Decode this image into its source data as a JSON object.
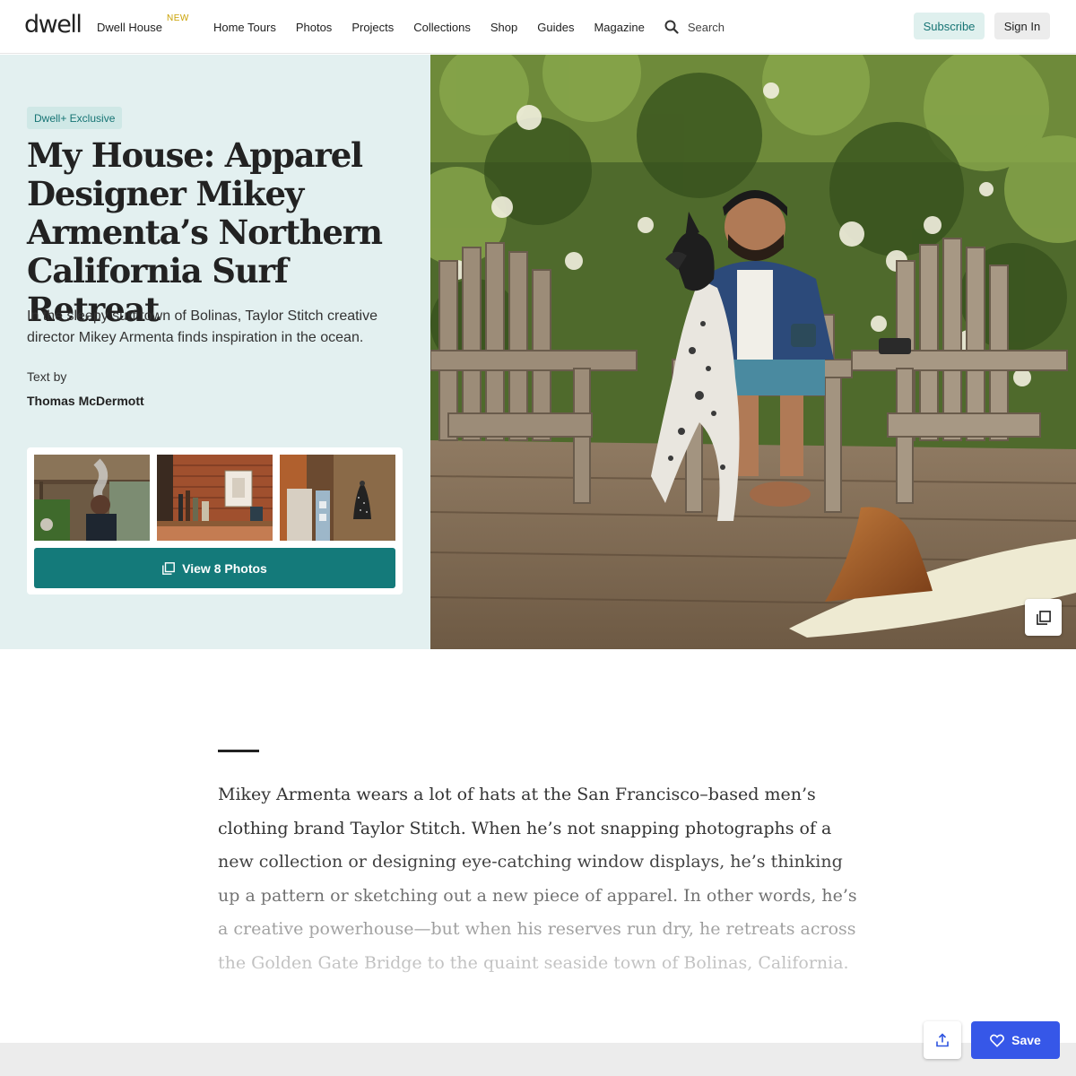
{
  "brand": {
    "logo_text": "dwell"
  },
  "nav": {
    "items": [
      {
        "label": "Dwell House",
        "tag": "NEW"
      },
      {
        "label": "Home Tours"
      },
      {
        "label": "Photos"
      },
      {
        "label": "Projects"
      },
      {
        "label": "Collections"
      },
      {
        "label": "Shop"
      },
      {
        "label": "Guides"
      },
      {
        "label": "Magazine"
      }
    ],
    "search_label": "Search",
    "subscribe_label": "Subscribe",
    "signin_label": "Sign In"
  },
  "hero": {
    "badge": "Dwell+ Exclusive",
    "title": "My House: Apparel Designer Mikey Armenta’s Northern California Surf Retreat",
    "dek": "In the sleepy surf town of Bolinas, Taylor Stitch creative director Mikey Armenta finds inspiration in the ocean.",
    "byline_label": "Text by",
    "byline_name": "Thomas McDermott",
    "gallery_button": "View 8 Photos"
  },
  "article": {
    "body": "Mikey Armenta wears a lot of hats at the San Francisco–based men’s clothing brand Taylor Stitch. When he’s not snapping photographs of a new collection or designing eye-catching window displays, he’s thinking up a pattern or sketching out a new piece of apparel. In other words, he’s a creative powerhouse—but when his reserves run dry, he retreats across the Golden Gate Bridge to the quaint seaside town of Bolinas, California."
  },
  "actions": {
    "save_label": "Save"
  },
  "colors": {
    "teal": "#147a7a",
    "hero_bg": "#e3f0f0",
    "save_blue": "#3657e8"
  },
  "icons": [
    "search-icon",
    "gallery-icon",
    "share-icon",
    "heart-icon"
  ]
}
